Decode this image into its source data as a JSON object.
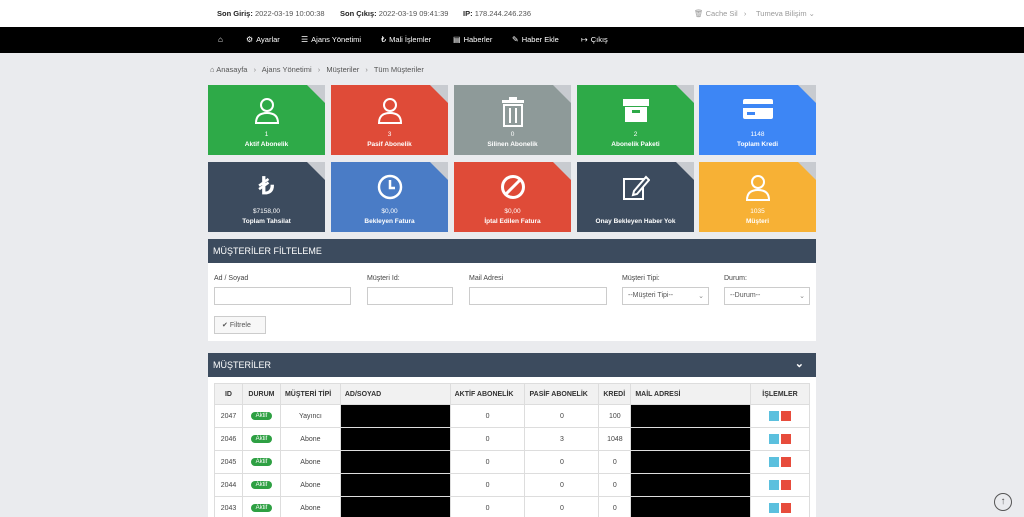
{
  "topbar": {
    "last_login_label": "Son Giriş:",
    "last_login_value": "2022-03-19 10:00:38",
    "last_logout_label": "Son Çıkış:",
    "last_logout_value": "2022-03-19 09:41:39",
    "ip_label": "IP:",
    "ip_value": "178.244.246.236",
    "cache_label": "Cache Sil",
    "user_label": "Tumeva Bilişim"
  },
  "nav": [
    {
      "label": "",
      "icon": "home-icon"
    },
    {
      "label": "Ayarlar",
      "icon": "gear-icon"
    },
    {
      "label": "Ajans Yönetimi",
      "icon": "menu-icon"
    },
    {
      "label": "Mali İşlemler",
      "icon": "money-icon"
    },
    {
      "label": "Haberler",
      "icon": "news-icon"
    },
    {
      "label": "Haber Ekle",
      "icon": "edit-icon"
    },
    {
      "label": "Çıkış",
      "icon": "logout-icon"
    }
  ],
  "breadcrumb": [
    "Anasayfa",
    "Ajans Yönetimi",
    "Müşteriler",
    "Tüm Müşteriler"
  ],
  "tiles": [
    {
      "num": "1",
      "label": "Aktif Abonelik",
      "color": "#2eaa48",
      "icon": "user-icon"
    },
    {
      "num": "3",
      "label": "Pasif Abonelik",
      "color": "#df4b38",
      "icon": "user-icon"
    },
    {
      "num": "0",
      "label": "Silinen Abonelik",
      "color": "#8e9a99",
      "icon": "trash-icon"
    },
    {
      "num": "2",
      "label": "Abonelik Paketi",
      "color": "#2eaa48",
      "icon": "archive-icon"
    },
    {
      "num": "1148",
      "label": "Toplam Kredi",
      "color": "#3d86f5",
      "icon": "credit-card-icon"
    },
    {
      "num": "$7158,00",
      "label": "Toplam Tahsilat",
      "color": "#3c4b5e",
      "icon": "lira-icon"
    },
    {
      "num": "$0,00",
      "label": "Bekleyen Fatura",
      "color": "#4a7cc6",
      "icon": "clock-icon"
    },
    {
      "num": "$0,00",
      "label": "İptal Edilen Fatura",
      "color": "#df4b38",
      "icon": "ban-icon"
    },
    {
      "num": "",
      "label": "Onay Bekleyen Haber Yok",
      "color": "#3c4b5e",
      "icon": "edit-icon"
    },
    {
      "num": "1035",
      "label": "Müşteri",
      "color": "#f7b135",
      "icon": "user-icon"
    }
  ],
  "filter": {
    "title": "MÜŞTERİLER FİLTELEME",
    "name_label": "Ad / Soyad",
    "id_label": "Müşteri Id:",
    "mail_label": "Mail Adresi",
    "type_label": "Müşteri Tipi:",
    "type_value": "--Müşteri Tipi--",
    "status_label": "Durum:",
    "status_value": "--Durum--",
    "button_label": "Filtrele"
  },
  "customers": {
    "title": "MÜŞTERİLER",
    "columns": [
      "ID",
      "DURUM",
      "MÜŞTERİ TİPİ",
      "AD/SOYAD",
      "AKTİF ABONELİK",
      "PASİF ABONELİK",
      "KREDİ",
      "MAİL ADRESİ",
      "İŞLEMLER"
    ],
    "rows": [
      {
        "id": "2047",
        "status": "Aktif",
        "type": "Yayıncı",
        "active": "0",
        "passive": "0",
        "credit": "100"
      },
      {
        "id": "2046",
        "status": "Aktif",
        "type": "Abone",
        "active": "0",
        "passive": "3",
        "credit": "1048"
      },
      {
        "id": "2045",
        "status": "Aktif",
        "type": "Abone",
        "active": "0",
        "passive": "0",
        "credit": "0"
      },
      {
        "id": "2044",
        "status": "Aktif",
        "type": "Abone",
        "active": "0",
        "passive": "0",
        "credit": "0"
      },
      {
        "id": "2043",
        "status": "Aktif",
        "type": "Abone",
        "active": "0",
        "passive": "0",
        "credit": "0"
      }
    ]
  }
}
